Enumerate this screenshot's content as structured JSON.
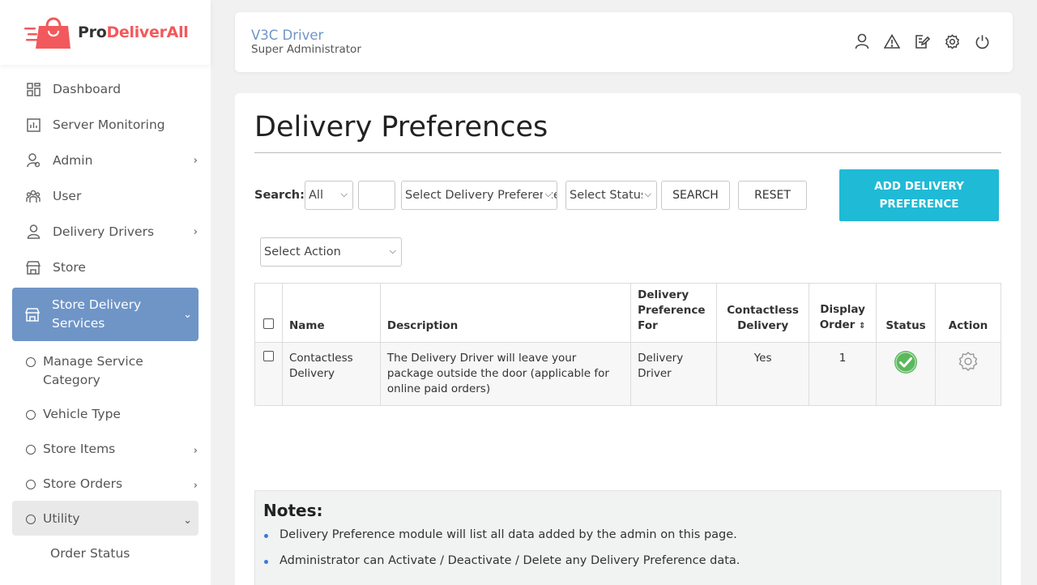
{
  "brand": {
    "pro": "Pro",
    "rest": "DeliverAll",
    "accent": "#f2595c"
  },
  "sidebar": {
    "items": [
      {
        "label": "Dashboard",
        "icon": "dashboard-icon"
      },
      {
        "label": "Server Monitoring",
        "icon": "chart-icon"
      },
      {
        "label": "Admin",
        "icon": "admin-user-icon",
        "has_children": true
      },
      {
        "label": "User",
        "icon": "users-icon"
      },
      {
        "label": "Delivery Drivers",
        "icon": "driver-icon",
        "has_children": true
      },
      {
        "label": "Store",
        "icon": "store-icon"
      },
      {
        "label": "Store Delivery Services",
        "icon": "store-icon",
        "active": true
      }
    ],
    "sub_items": [
      {
        "label": "Manage Service Category"
      },
      {
        "label": "Vehicle Type"
      },
      {
        "label": "Store Items",
        "has_children": true
      },
      {
        "label": "Store Orders",
        "has_children": true
      },
      {
        "label": "Utility",
        "expanded": true
      }
    ],
    "subsub_items": [
      {
        "label": "Order Status"
      }
    ]
  },
  "header": {
    "name": "V3C Driver",
    "role": "Super Administrator",
    "icons": [
      "profile-icon",
      "alert-icon",
      "edit-icon",
      "settings-icon",
      "power-icon"
    ]
  },
  "page": {
    "title": "Delivery Preferences",
    "search_label": "Search:",
    "filter_all": "All",
    "filter_preference": "Select Delivery Preference",
    "filter_status": "Select Status",
    "search_button": "SEARCH",
    "reset_button": "RESET",
    "add_button_line1": "ADD DELIVERY",
    "add_button_line2": "PREFERENCE",
    "action_select": "Select Action",
    "accent": "#1fbad6"
  },
  "table": {
    "headers": {
      "name": "Name",
      "description": "Description",
      "preference_for": "Delivery Preference For",
      "contactless": "Contactless Delivery",
      "display_order": "Display Order",
      "status": "Status",
      "action": "Action"
    },
    "rows": [
      {
        "name": "Contactless Delivery",
        "description": "The Delivery Driver will leave your package outside the door (applicable for online paid orders)",
        "preference_for": "Delivery Driver",
        "contactless": "Yes",
        "display_order": "1",
        "status": "active",
        "status_color": "#5cb85c"
      }
    ]
  },
  "notes": {
    "title": "Notes:",
    "items": [
      "Delivery Preference module will list all data added by the admin on this page.",
      "Administrator can Activate / Deactivate / Delete any Delivery Preference data."
    ]
  }
}
